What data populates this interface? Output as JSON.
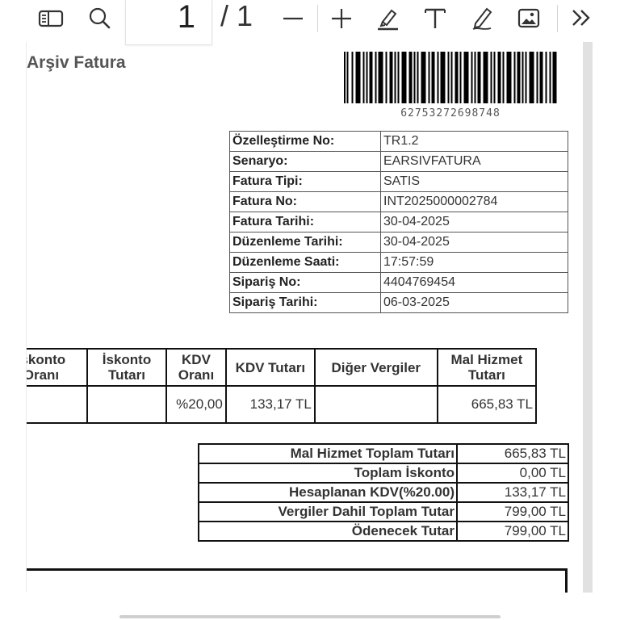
{
  "toolbar": {
    "current_page": "1",
    "page_total": "/ 1",
    "icons": [
      "sidebar-icon",
      "search-icon",
      "zoom-out-icon",
      "zoom-in-icon",
      "highlight-icon",
      "text-icon",
      "draw-icon",
      "image-icon",
      "more-icon"
    ]
  },
  "document": {
    "title": "Arşiv Fatura",
    "barcode_number": "62753272698748",
    "info": [
      {
        "label": "Özelleştirme No:",
        "value": "TR1.2"
      },
      {
        "label": "Senaryo:",
        "value": "EARSIVFATURA"
      },
      {
        "label": "Fatura Tipi:",
        "value": "SATIS"
      },
      {
        "label": "Fatura No:",
        "value": "INT2025000002784"
      },
      {
        "label": "Fatura Tarihi:",
        "value": "30-04-2025"
      },
      {
        "label": "Düzenleme Tarihi:",
        "value": "30-04-2025"
      },
      {
        "label": "Düzenleme Saati:",
        "value": "17:57:59"
      },
      {
        "label": "Sipariş No:",
        "value": "4404769454"
      },
      {
        "label": "Sipariş Tarihi:",
        "value": "06-03-2025"
      }
    ],
    "items_table": {
      "headers": [
        "İskonto Oranı",
        "İskonto Tutarı",
        "KDV Oranı",
        "KDV Tutarı",
        "Diğer Vergiler",
        "Mal Hizmet Tutarı"
      ],
      "row": [
        "",
        "",
        "%20,00",
        "133,17 TL",
        "",
        "665,83 TL"
      ]
    },
    "totals": [
      {
        "label": "Mal Hizmet Toplam Tutarı",
        "value": "665,83 TL"
      },
      {
        "label": "Toplam İskonto",
        "value": "0,00 TL"
      },
      {
        "label": "Hesaplanan KDV(%20.00)",
        "value": "133,17 TL"
      },
      {
        "label": "Vergiler Dahil Toplam Tutar",
        "value": "799,00 TL"
      },
      {
        "label": "Ödenecek Tutar",
        "value": "799,00 TL"
      }
    ]
  }
}
